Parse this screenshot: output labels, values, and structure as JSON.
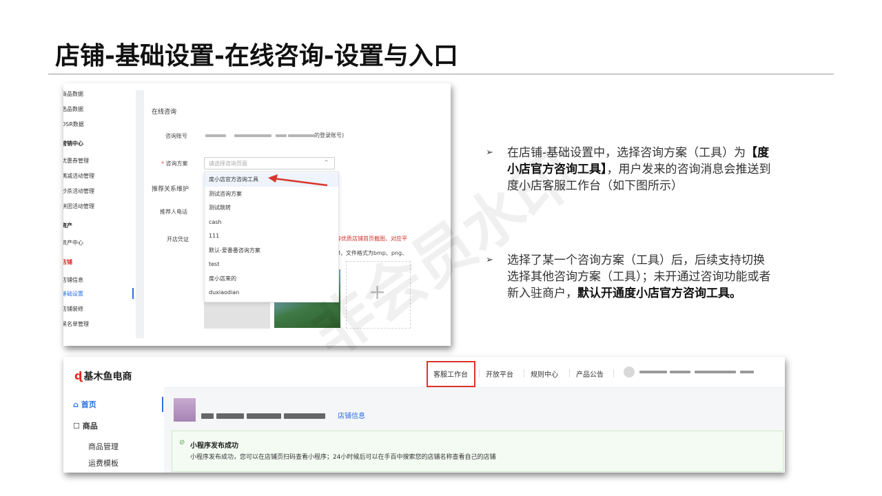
{
  "title": "店铺-基础设置-在线咨询-设置与入口",
  "watermark": "非会员水印",
  "admin": {
    "nav": [
      {
        "label": "商品数据",
        "style": ""
      },
      {
        "label": "选品数据",
        "style": ""
      },
      {
        "label": "DSR数据",
        "style": ""
      },
      {
        "label": "营销中心",
        "style": "group"
      },
      {
        "label": "优惠券管理",
        "style": ""
      },
      {
        "label": "满减活动管理",
        "style": ""
      },
      {
        "label": "秒杀活动管理",
        "style": ""
      },
      {
        "label": "拼团活动管理",
        "style": ""
      },
      {
        "label": "资产",
        "style": "group"
      },
      {
        "label": "资产中心",
        "style": ""
      },
      {
        "label": "店铺",
        "style": "red"
      },
      {
        "label": "店铺信息",
        "style": ""
      },
      {
        "label": "基础设置",
        "style": "active"
      },
      {
        "label": "店铺装修",
        "style": ""
      },
      {
        "label": "黑名单管理",
        "style": ""
      }
    ],
    "section_title": "在线咨询",
    "account_label": "咨询账号",
    "account_hint": "的登录账号)",
    "scheme_required_mark": "*",
    "scheme_label": "咨询方案",
    "scheme_placeholder": "请选择咨询页面",
    "referral_label": "推荐关系维护",
    "referrer_phone_label": "推荐人电话",
    "credential_label": "开店凭证",
    "credential_note_red": "等优质店铺首页截图、对应平",
    "credential_note_gray": "M，文件格式为bmp、png、",
    "dropdown_options": [
      {
        "label": "度小店官方咨询工具",
        "highlighted": true
      },
      {
        "label": "测试咨询方案",
        "highlighted": false
      },
      {
        "label": "测试跳转",
        "highlighted": false
      },
      {
        "label": "cash",
        "highlighted": false
      },
      {
        "label": "111",
        "highlighted": false
      },
      {
        "label": "默认-爱番番咨询方案",
        "highlighted": false
      },
      {
        "label": "test",
        "highlighted": false
      },
      {
        "label": "度小店来的",
        "highlighted": false
      },
      {
        "label": "duxiaodian",
        "highlighted": false
      }
    ]
  },
  "bullets": [
    {
      "marker": "➢",
      "parts": [
        {
          "text": "在店铺-基础设置中，选择咨询方案（工具）为",
          "bold": false
        },
        {
          "text": "【度小店官方咨询工具】",
          "bold": true
        },
        {
          "text": "，用户发来的咨询消息会推送到度小店客服工作台（如下图所示）",
          "bold": false
        }
      ]
    },
    {
      "marker": "➢",
      "parts": [
        {
          "text": "选择了某一个咨询方案（工具）后，后续支持切换选择其他咨询方案（工具）；未开通过咨询功能或者新入驻商户，",
          "bold": false
        },
        {
          "text": "默认开通度小店官方咨询工具。",
          "bold": true
        }
      ]
    }
  ],
  "merchant": {
    "logo_mark": "ɖ",
    "logo_text": "基木鱼电商",
    "side_home": "首页",
    "side_goods": "商品",
    "side_goods_manage": "商品管理",
    "side_shipping": "运费模板",
    "top_nav": [
      "客服工作台",
      "开放平台",
      "规则中心",
      "产品公告"
    ],
    "shop_info_link": "店铺信息",
    "banner_title": "小程序发布成功",
    "banner_text": "小程序发布成功，您可以在店铺页扫码查看小程序；24小时候后可以在手百中搜索您的店铺名称查看自己的店铺"
  }
}
